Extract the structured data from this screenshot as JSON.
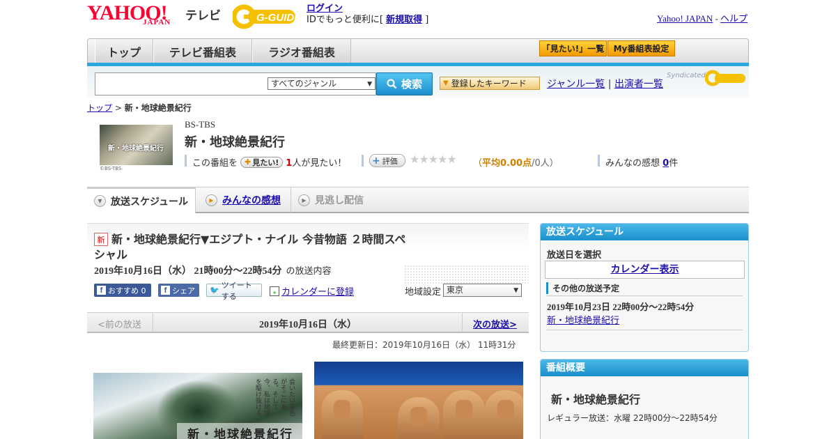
{
  "header": {
    "yahoo": "YAHOO!",
    "japan": "JAPAN",
    "tv": "テレビ",
    "gguide": "G-GUIDE",
    "login": "ログイン",
    "id_text": "IDでもっと便利に[",
    "signup": "新規取得",
    "id_close": "]",
    "yahoo_japan_link": "Yahoo! JAPAN",
    "separator": "-",
    "help_link": "ヘルプ"
  },
  "nav": {
    "tabs": [
      "トップ",
      "テレビ番組表",
      "ラジオ番組表"
    ],
    "want_list": "「見たい!」一覧",
    "my_settings": "My番組表設定"
  },
  "search": {
    "placeholder": "",
    "genre": "すべてのジャンル",
    "button": "検索",
    "keyword_button": "登録したキーワード",
    "genre_list": "ジャンル一覧",
    "pipe": "|",
    "performers": "出演者一覧",
    "syndicated": "Syndicated"
  },
  "breadcrumb": {
    "top": "トップ",
    "sep": ">",
    "current": "新・地球絶景紀行"
  },
  "program": {
    "thumb_text": "新・地球絶景紀行",
    "thumb_credit": "©BS-TBS",
    "channel": "BS-TBS",
    "title": "新・地球絶景紀行",
    "want_prefix": "この番組を",
    "want_button": "見たい!",
    "want_count": "1",
    "want_suffix": "人が見たい！",
    "rate_button": "評価",
    "stars": "★★★★★",
    "avg_open": "（",
    "avg_label": "平均0.00点",
    "avg_people": "/0人）",
    "impressions_prefix": "みんなの感想",
    "impressions_count": "0",
    "impressions_suffix": "件"
  },
  "tabs": {
    "schedule": "放送スケジュール",
    "impressions": "みんなの感想",
    "missed": "見逃し配信"
  },
  "episode": {
    "new_badge": "新",
    "title": "新・地球絶景紀行▼エジプト・ナイル 今昔物語 ２時間スペシャル",
    "date": "2019年10月16日（水） 21時00分～22時54分",
    "date_suffix": "の放送内容",
    "recommend": "おすすめ 0",
    "share": "シェア",
    "tweet": "ツイートする",
    "calendar": "カレンダーに登録",
    "region_label": "地域設定",
    "region": "東京"
  },
  "pager": {
    "prev": "<前の放送",
    "date": "2019年10月16日（水）",
    "next": "次の放送>"
  },
  "last_updated": "最終更新日：2019年10月16日（水） 11時31分",
  "image1": {
    "title": "新・地球絶景紀行",
    "vertical_text": "会いたい景色がそこにある。そして今、私は地球を駆け抜ける"
  },
  "sidebar": {
    "schedule_head": "放送スケジュール",
    "choose_date": "放送日を選択",
    "calendar_display": "カレンダー表示",
    "other_head": "その他の放送予定",
    "other_date": "2019年10月23日 22時00分～22時54分",
    "other_title": "新・地球絶景紀行",
    "overview_head": "番組概要",
    "overview_title": "新・地球絶景紀行",
    "overview_regular": "レギュラー放送：水曜 22時00分～22時54分"
  }
}
